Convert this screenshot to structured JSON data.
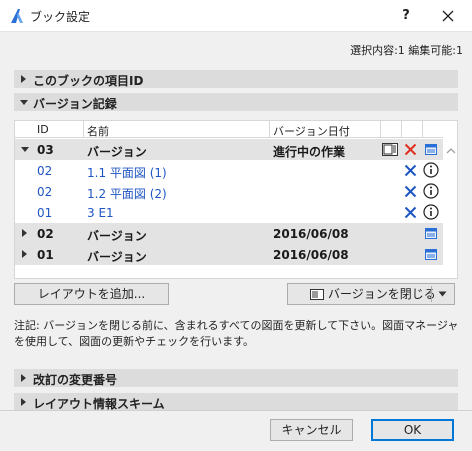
{
  "window": {
    "title": "ブック設定",
    "help_label": "?"
  },
  "selection_info": "選択内容:1 編集可能:1",
  "sections": {
    "book_id": "このブックの項目ID",
    "revision_history": "バージョン記録",
    "change_number": "改訂の変更番号",
    "layout_scheme": "レイアウト情報スキーム"
  },
  "table": {
    "headers": {
      "id": "ID",
      "name": "名前",
      "date": "バージョン日付"
    },
    "rows": [
      {
        "kind": "group",
        "expanded": true,
        "id": "03",
        "name": "バージョン",
        "date": "進行中の作業",
        "icons": [
          "layout-icon",
          "delete-icon",
          "info-card-icon"
        ]
      },
      {
        "kind": "child",
        "id": "02",
        "name": "1.1 平面図 (1)",
        "icons": [
          "delete-icon",
          "info-icon"
        ]
      },
      {
        "kind": "child",
        "id": "02",
        "name": "1.2 平面図 (2)",
        "icons": [
          "delete-icon",
          "info-icon"
        ]
      },
      {
        "kind": "child",
        "id": "01",
        "name": "3 E1",
        "icons": [
          "delete-icon",
          "info-icon"
        ]
      },
      {
        "kind": "group",
        "expanded": false,
        "id": "02",
        "name": "バージョン",
        "date": "2016/06/08",
        "icons": [
          "info-card-icon"
        ]
      },
      {
        "kind": "group",
        "expanded": false,
        "id": "01",
        "name": "バージョン",
        "date": "2016/06/08",
        "icons": [
          "info-card-icon"
        ]
      }
    ]
  },
  "buttons": {
    "add_layout": "レイアウトを追加...",
    "close_revision": "バージョンを閉じる",
    "cancel": "キャンセル",
    "ok": "OK"
  },
  "note": "注記: バージョンを閉じる前に、含まれるすべての図面を更新して下さい。図面マネージャを使用して、図面の更新やチェックを行います。",
  "colors": {
    "accent": "#1f56c2",
    "delete": "#1f56c2",
    "delete_group": "#e03020",
    "ok_border": "#0078d7"
  }
}
